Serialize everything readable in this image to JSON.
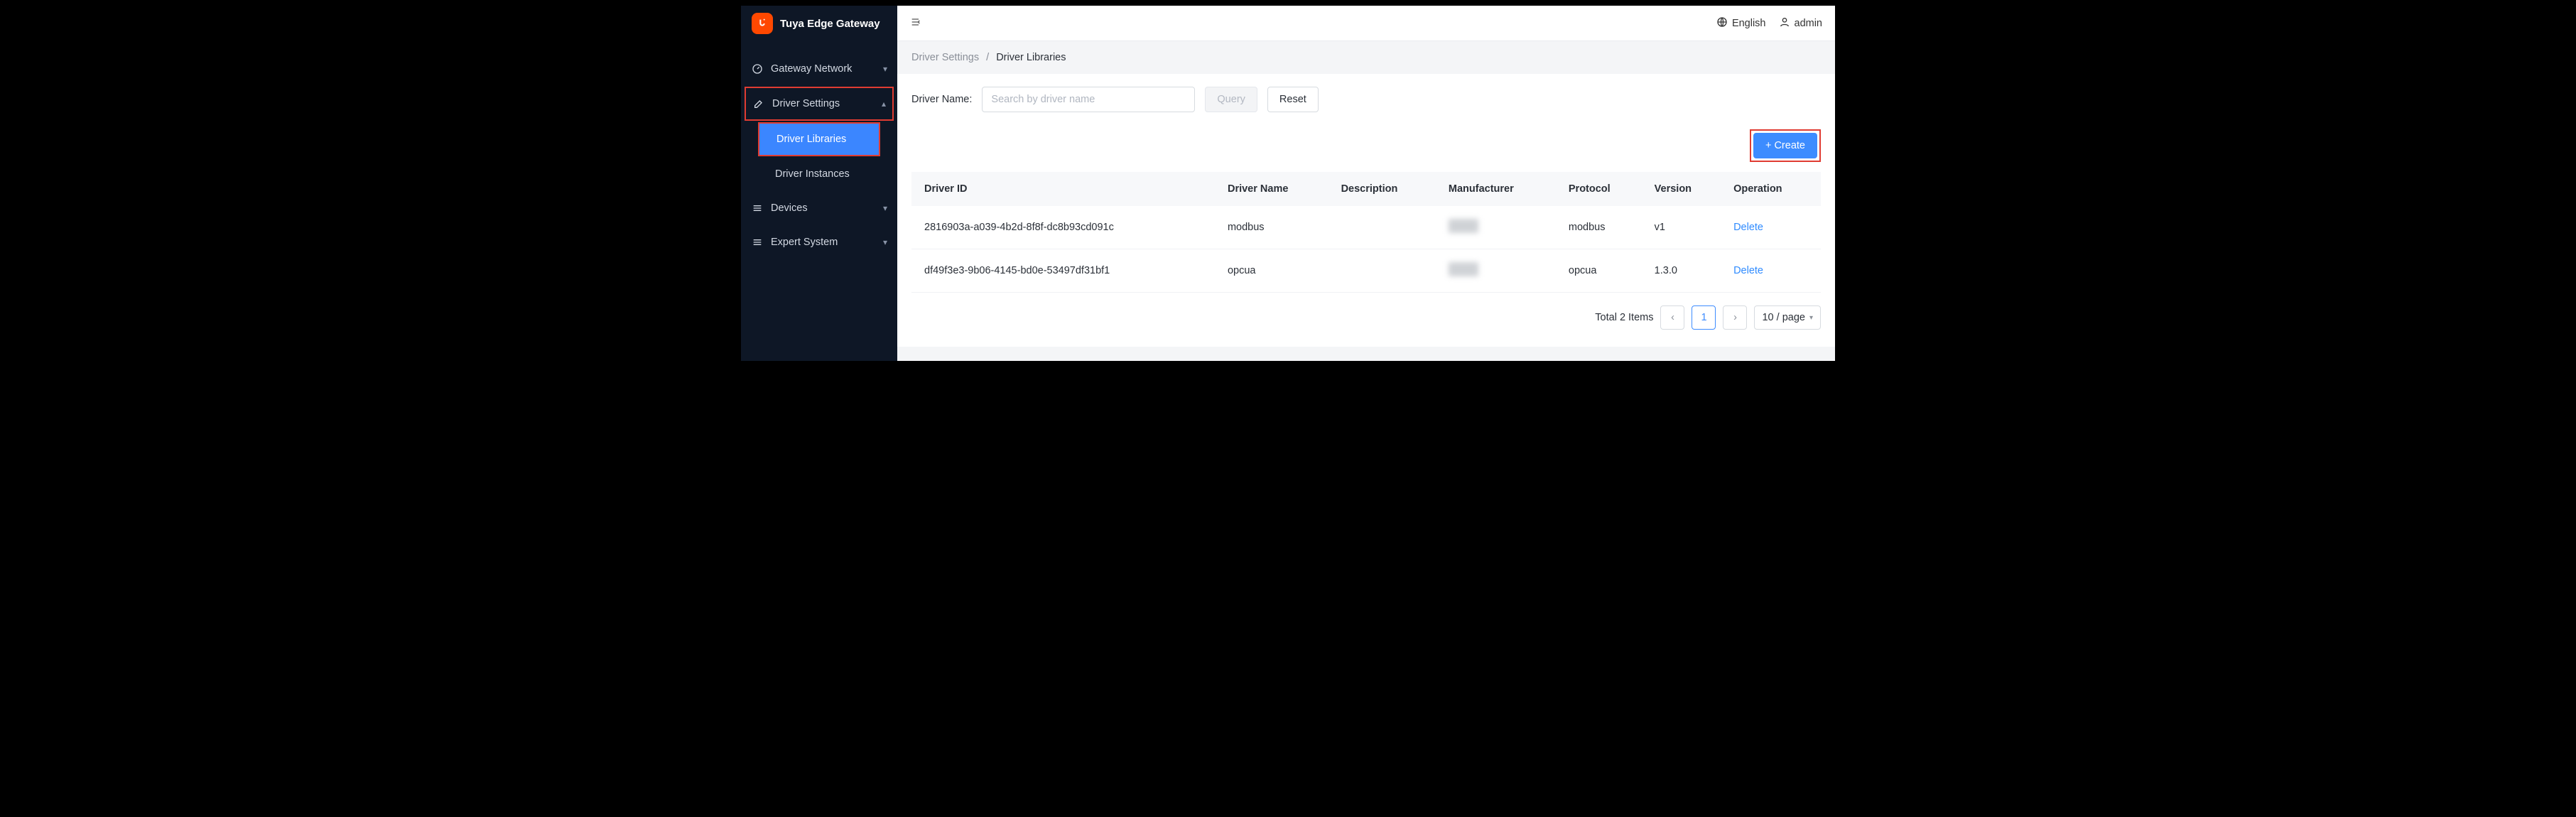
{
  "brand": {
    "title": "Tuya Edge Gateway"
  },
  "sidebar": {
    "items": [
      {
        "label": "Gateway Network"
      },
      {
        "label": "Driver Settings",
        "sub": [
          {
            "label": "Driver Libraries"
          },
          {
            "label": "Driver Instances"
          }
        ]
      },
      {
        "label": "Devices"
      },
      {
        "label": "Expert System"
      }
    ]
  },
  "topbar": {
    "lang": "English",
    "user": "admin"
  },
  "breadcrumb": {
    "parent": "Driver Settings",
    "current": "Driver Libraries"
  },
  "filter": {
    "label": "Driver Name:",
    "placeholder": "Search by driver name",
    "query": "Query",
    "reset": "Reset"
  },
  "actions": {
    "create": "+ Create"
  },
  "table": {
    "headers": [
      "Driver ID",
      "Driver Name",
      "Description",
      "Manufacturer",
      "Protocol",
      "Version",
      "Operation"
    ],
    "rows": [
      {
        "id": "2816903a-a039-4b2d-8f8f-dc8b93cd091c",
        "name": "modbus",
        "desc": "",
        "manu": "(hidden)",
        "proto": "modbus",
        "ver": "v1",
        "op": "Delete"
      },
      {
        "id": "df49f3e3-9b06-4145-bd0e-53497df31bf1",
        "name": "opcua",
        "desc": "",
        "manu": "(hidden)",
        "proto": "opcua",
        "ver": "1.3.0",
        "op": "Delete"
      }
    ]
  },
  "pagination": {
    "total_label": "Total 2 Items",
    "page": "1",
    "pagesize": "10 / page"
  }
}
